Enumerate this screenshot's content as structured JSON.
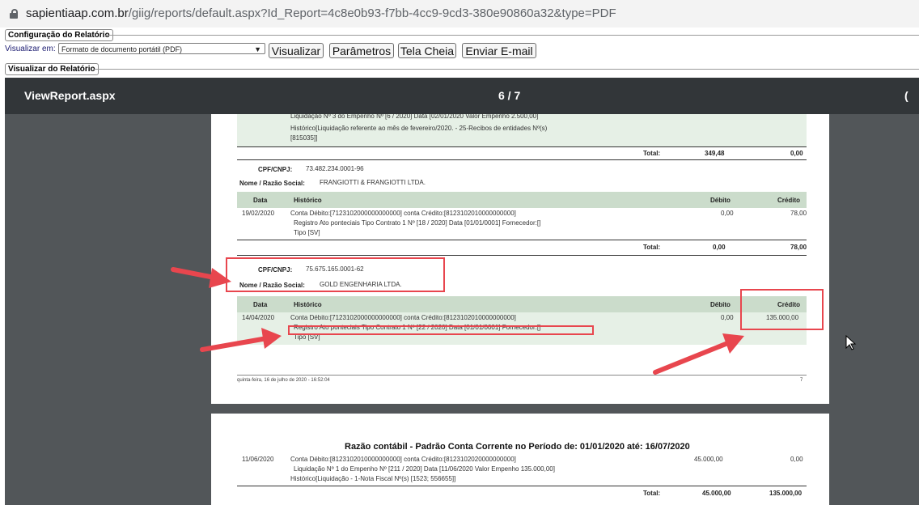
{
  "browser": {
    "url_host": "sapientiaap.com.br",
    "url_path": "/giig/reports/default.aspx?Id_Report=4c8e0b93-f7bb-4cc9-9cd3-380e90860a32&type=PDF"
  },
  "config": {
    "legend": "Configuração do Relatório",
    "view_label": "Visualizar em:",
    "format_value": "Formato de documento portátil (PDF)",
    "buttons": [
      "Visualizar",
      "Parâmetros",
      "Tela Cheia",
      "Enviar E-mail"
    ],
    "report_legend": "Visualizar do Relatório"
  },
  "viewer": {
    "title": "ViewReport.aspx",
    "page_indicator": "6 / 7",
    "edge_glyph": "("
  },
  "page1": {
    "top_line1": "Liquidação Nº 3 do Empenho Nº [6 / 2020] Data [02/01/2020 Valor Empenho 2.500,00]",
    "top_line2": "Histórico[Liquidação referente ao mês de fevereiro/2020. - 25-Recibos de entidades Nº(s)",
    "top_line3": "[815035]]",
    "total_label": "Total:",
    "total1_debito": "349,48",
    "total1_credito": "0,00",
    "cpf_label": "CPF/CNPJ:",
    "razao_label": "Nome / Razão Social:",
    "block1": {
      "cpf": "73.482.234.0001-96",
      "razao": "FRANGIOTTI & FRANGIOTTI LTDA.",
      "date": "19/02/2020",
      "line1": "Conta Débito:[7123102000000000000] conta Crédito:[8123102010000000000]",
      "line2": "Registro Ato ponteciais Tipo Contrato 1 Nº [18 / 2020] Data [01/01/0001] Fornecedor:[]",
      "line3": "Tipo [SV]",
      "debito": "0,00",
      "credito": "78,00",
      "total_debito": "0,00",
      "total_credito": "78,00"
    },
    "block2": {
      "cpf": "75.675.165.0001-62",
      "razao": "GOLD ENGENHARIA LTDA.",
      "date": "14/04/2020",
      "line1": "Conta Débito:[7123102000000000000] conta Crédito:[8123102010000000000]",
      "line2": "Registro Ato ponteciais Tipo Contrato 1 Nº [22 / 2020] Data [01/01/0001] Fornecedor:[]",
      "line3": "Tipo [SV]",
      "debito": "0,00",
      "credito": "135.000,00"
    },
    "headers": {
      "data": "Data",
      "historico": "Histórico",
      "debito": "Débito",
      "credito": "Crédito"
    },
    "footer_date": "quinta-feira, 16 de julho de 2020 - 16:52:04",
    "footer_page": "7"
  },
  "page2": {
    "heading": "Razão contábil - Padrão Conta Corrente no Período de: 01/01/2020 até: 16/07/2020",
    "date": "11/06/2020",
    "line1": "Conta Débito:[8123102010000000000] conta Crédito:[8123102020000000000]",
    "line2": "Liquidação Nº 1 do Empenho Nº [211 / 2020] Data [11/06/2020 Valor Empenho 135.000,00]",
    "line3": "Histórico[Liquidação - 1-Nota Fiscal Nº(s) [1523; 556655]]",
    "debito": "45.000,00",
    "credito": "0,00",
    "total_label": "Total:",
    "total_debito": "45.000,00",
    "total_credito": "135.000,00"
  },
  "colors": {
    "annotation": "#e8464e",
    "toolbar": "#323639",
    "viewer_bg": "#525659",
    "row_header": "#cbdccb",
    "row_tint": "#e6f0e6"
  }
}
